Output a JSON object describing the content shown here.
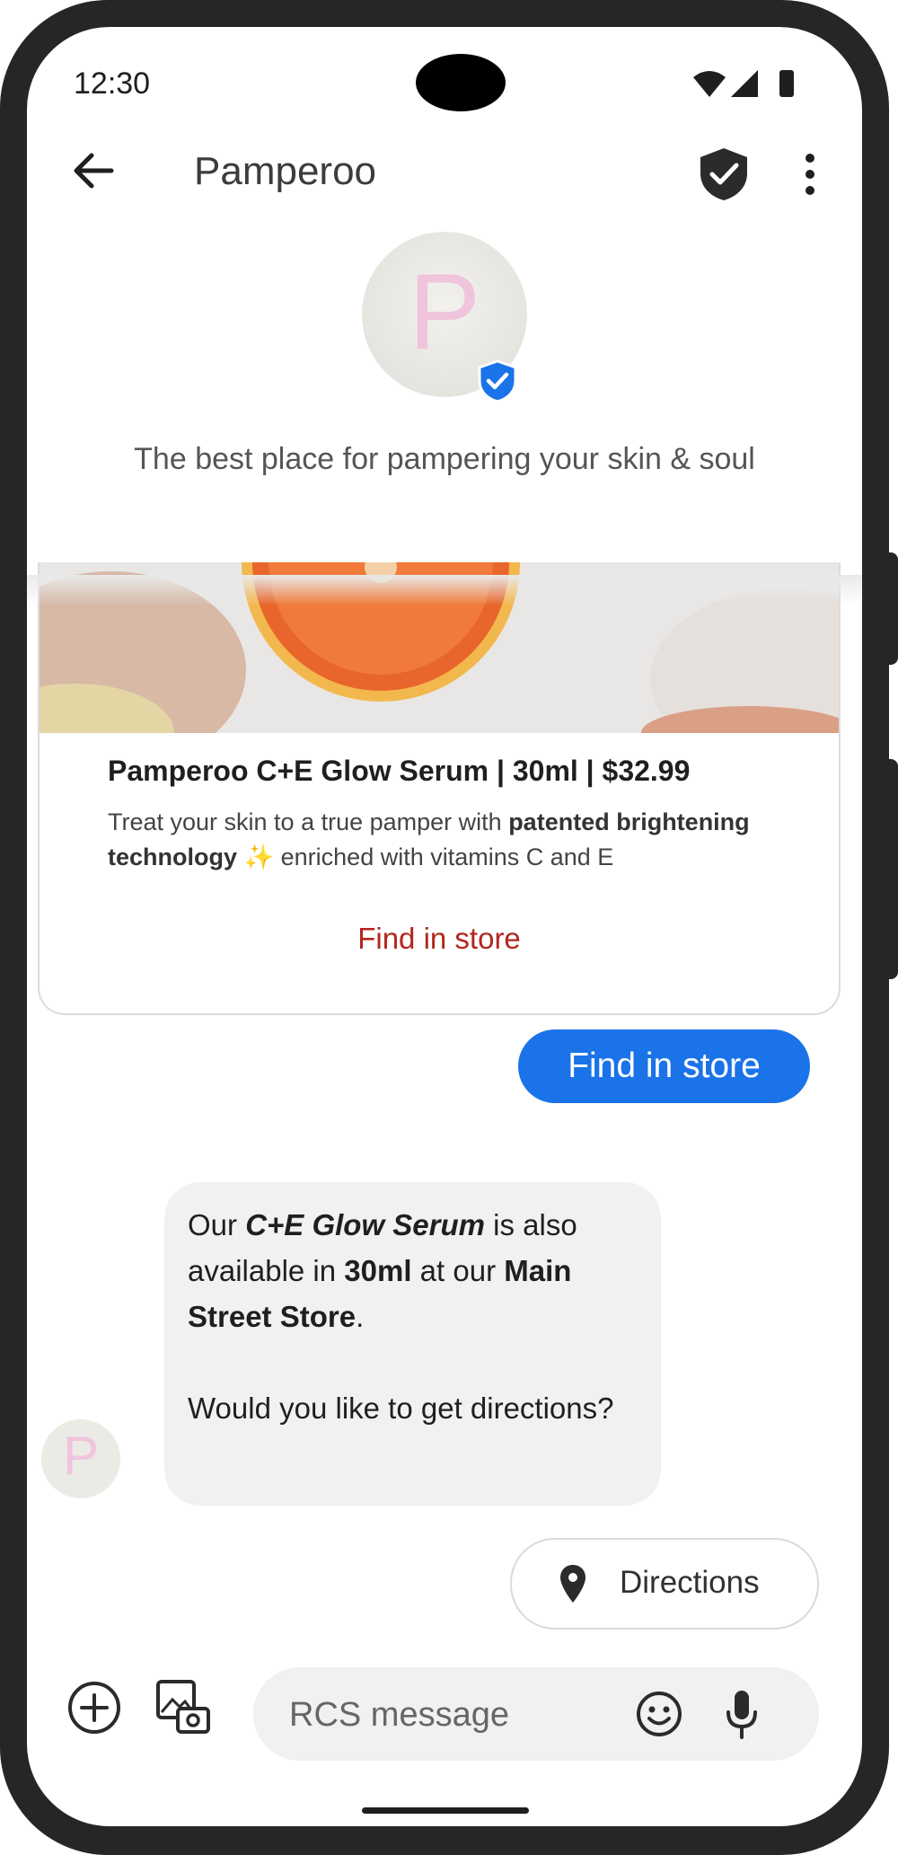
{
  "status_bar": {
    "time": "12:30"
  },
  "app_bar": {
    "title": "Pamperoo"
  },
  "profile": {
    "avatar_letter": "P",
    "tagline": "The best place for pampering your skin & soul"
  },
  "rich_card": {
    "title": "Pamperoo C+E Glow Serum | 30ml | $32.99",
    "description_prefix": "Treat your skin to a true pamper with ",
    "description_bold": "patented brightening technology",
    "description_emoji": " ✨",
    "description_suffix": " enriched with vitamins C and E",
    "action_label": "Find in store"
  },
  "sent_message": {
    "text": "Find in store"
  },
  "received_message": {
    "part1": "Our ",
    "product": "C+E Glow Serum",
    "part2": " is also available in ",
    "size": "30ml",
    "part3": " at our ",
    "store": "Main Street Store",
    "part4": ".",
    "question": "Would you like to get directions?",
    "avatar_letter": "P"
  },
  "suggestion_chip": {
    "label": "Directions",
    "icon": "location-pin-icon"
  },
  "composer": {
    "placeholder": "RCS message"
  },
  "colors": {
    "accent_blue": "#1a73e8",
    "action_red": "#b3261e",
    "bubble_grey": "#f1f1f1"
  }
}
